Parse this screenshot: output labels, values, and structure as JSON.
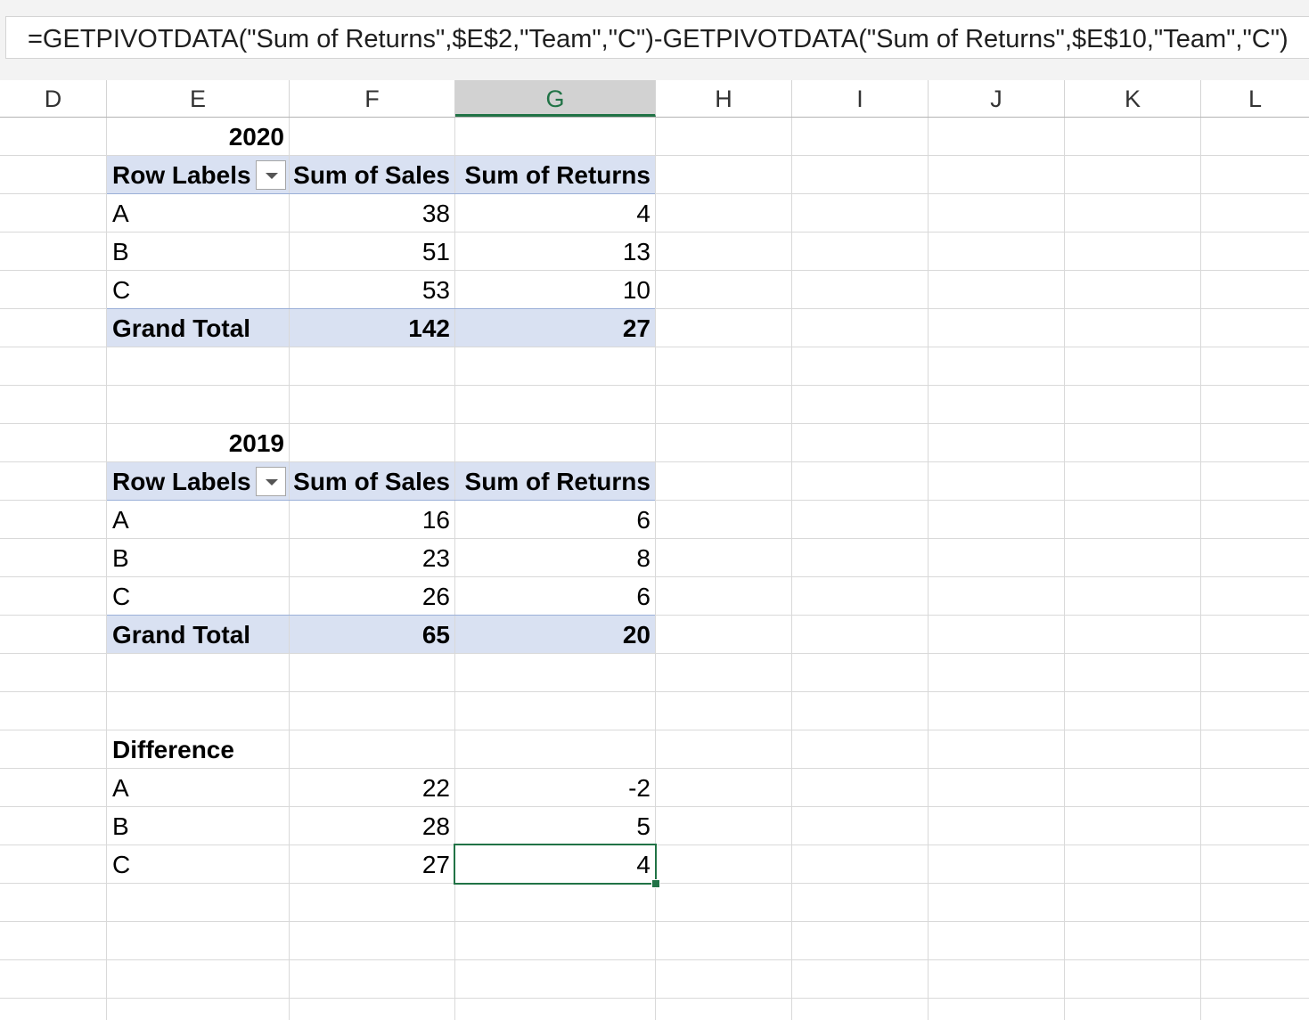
{
  "formula_bar": {
    "formula": "=GETPIVOTDATA(\"Sum of Returns\",$E$2,\"Team\",\"C\")-GETPIVOTDATA(\"Sum of Returns\",$E$10,\"Team\",\"C\")"
  },
  "columns": [
    "D",
    "E",
    "F",
    "G",
    "H",
    "I",
    "J",
    "K",
    "L"
  ],
  "selected_column": "G",
  "pivot_2020": {
    "title": "2020",
    "headers": [
      "Row Labels",
      "Sum of Sales",
      "Sum of Returns"
    ],
    "rows": [
      {
        "label": "A",
        "sales": "38",
        "returns": "4"
      },
      {
        "label": "B",
        "sales": "51",
        "returns": "13"
      },
      {
        "label": "C",
        "sales": "53",
        "returns": "10"
      }
    ],
    "total": {
      "label": "Grand Total",
      "sales": "142",
      "returns": "27"
    }
  },
  "pivot_2019": {
    "title": "2019",
    "headers": [
      "Row Labels",
      "Sum of Sales",
      "Sum of Returns"
    ],
    "rows": [
      {
        "label": "A",
        "sales": "16",
        "returns": "6"
      },
      {
        "label": "B",
        "sales": "23",
        "returns": "8"
      },
      {
        "label": "C",
        "sales": "26",
        "returns": "6"
      }
    ],
    "total": {
      "label": "Grand Total",
      "sales": "65",
      "returns": "20"
    }
  },
  "difference": {
    "title": "Difference",
    "rows": [
      {
        "label": "A",
        "sales": "22",
        "returns": "-2"
      },
      {
        "label": "B",
        "sales": "28",
        "returns": "5"
      },
      {
        "label": "C",
        "sales": "27",
        "returns": "4"
      }
    ]
  },
  "colors": {
    "pivot_band": "#d9e1f2",
    "selection": "#217346"
  }
}
